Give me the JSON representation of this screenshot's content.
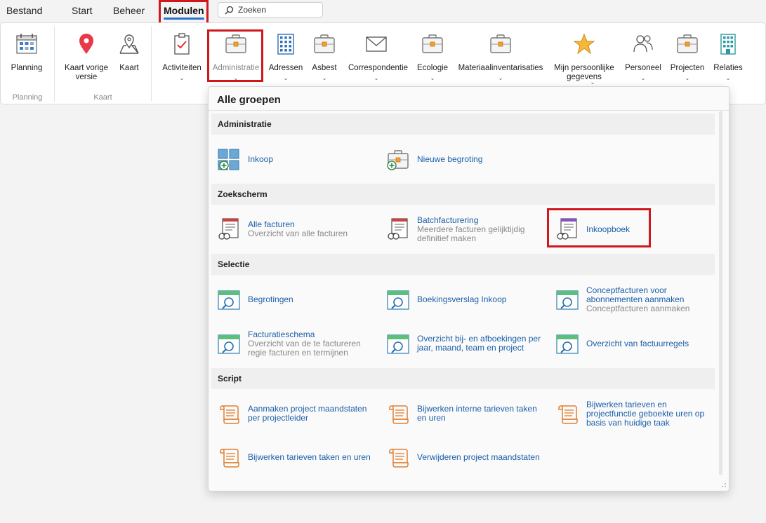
{
  "menu": {
    "tabs": [
      {
        "label": "Bestand"
      },
      {
        "label": "Start"
      },
      {
        "label": "Beheer"
      },
      {
        "label": "Modulen"
      }
    ],
    "search_placeholder": "Zoeken"
  },
  "ribbon": {
    "groups": [
      {
        "label": "Planning"
      },
      {
        "label": "Kaart"
      }
    ],
    "buttons": {
      "planning": "Planning",
      "kaart_vorige": "Kaart vorige versie",
      "kaart": "Kaart",
      "activiteiten": "Activiteiten",
      "administratie": "Administratie",
      "adressen": "Adressen",
      "asbest": "Asbest",
      "correspondentie": "Correspondentie",
      "ecologie": "Ecologie",
      "materiaal": "Materiaalinventarisaties",
      "persoonlijk": "Mijn persoonlijke gegevens",
      "personeel": "Personeel",
      "projecten": "Projecten",
      "relaties": "Relaties"
    }
  },
  "dropdown": {
    "title": "Alle groepen",
    "sections": {
      "administratie": "Administratie",
      "zoekscherm": "Zoekscherm",
      "selectie": "Selectie",
      "script": "Script"
    },
    "items": {
      "inkoop": {
        "title": "Inkoop"
      },
      "nieuwe_begroting": {
        "title": "Nieuwe begroting"
      },
      "alle_facturen": {
        "title": "Alle facturen",
        "sub": "Overzicht van alle facturen"
      },
      "batchfacturering": {
        "title": "Batchfacturering",
        "sub": "Meerdere facturen gelijktijdig definitief maken"
      },
      "inkoopboek": {
        "title": "Inkoopboek"
      },
      "begrotingen": {
        "title": "Begrotingen"
      },
      "boekingsverslag": {
        "title": "Boekingsverslag Inkoop"
      },
      "conceptfacturen": {
        "title": "Conceptfacturen voor abonnementen aanmaken",
        "sub": "Conceptfacturen aanmaken"
      },
      "facturatieschema": {
        "title": "Facturatieschema",
        "sub": "Overzicht van de te factureren regie facturen en termijnen"
      },
      "overzicht_boekingen": {
        "title": "Overzicht bij- en afboekingen per jaar, maand, team en project"
      },
      "overzicht_factuurregels": {
        "title": "Overzicht van factuurregels"
      },
      "aanmaken_maandstaten": {
        "title": "Aanmaken project maandstaten per projectleider"
      },
      "bijwerken_interne": {
        "title": "Bijwerken interne tarieven taken en uren"
      },
      "bijwerken_projectfunctie": {
        "title": "Bijwerken tarieven en projectfunctie geboekte uren op basis van huidige taak"
      },
      "bijwerken_taken": {
        "title": "Bijwerken tarieven taken en uren"
      },
      "verwijderen_maandstaten": {
        "title": "Verwijderen project maandstaten"
      }
    }
  },
  "colors": {
    "highlight": "#d0171c",
    "link": "#1a5fa8",
    "accent": "#2a6fc9"
  }
}
